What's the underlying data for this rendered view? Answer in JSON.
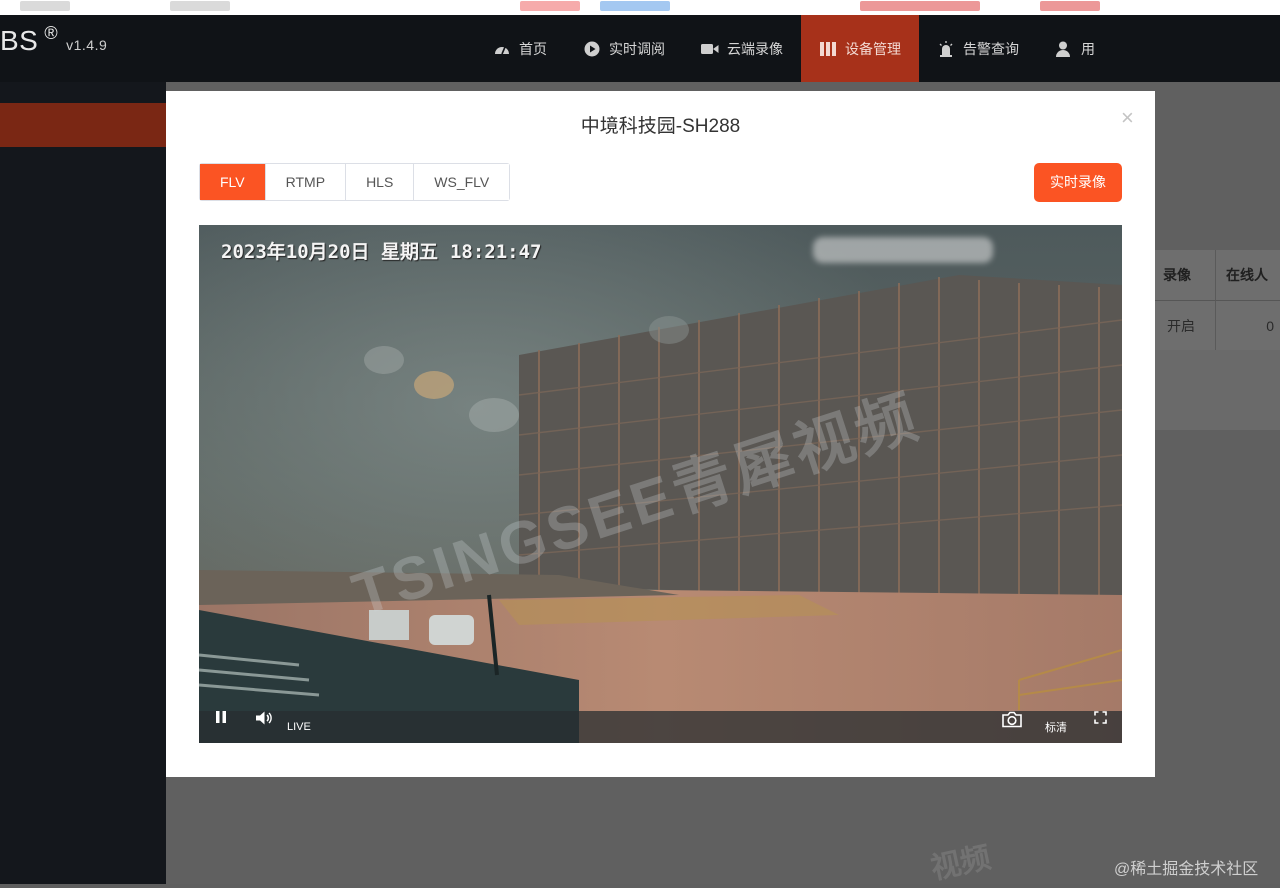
{
  "app": {
    "brand_name": "BS",
    "brand_mark": "®",
    "version": "v1.4.9"
  },
  "nav": {
    "items": [
      {
        "label": "首页",
        "icon": "dashboard-icon",
        "active": false
      },
      {
        "label": "实时调阅",
        "icon": "play-circle-icon",
        "active": false
      },
      {
        "label": "云端录像",
        "icon": "video-camera-icon",
        "active": false
      },
      {
        "label": "设备管理",
        "icon": "columns-icon",
        "active": true
      },
      {
        "label": "告警查询",
        "icon": "alarm-icon",
        "active": false
      },
      {
        "label": "用",
        "icon": "user-icon",
        "active": false
      }
    ]
  },
  "background_table": {
    "headers": [
      "录像",
      "在线人"
    ],
    "row": [
      "开启",
      "0"
    ]
  },
  "background_watermark": "视频",
  "site_watermark": "@稀土掘金技术社区",
  "modal": {
    "title": "中境科技园-SH288",
    "close_symbol": "×",
    "protocols": [
      {
        "label": "FLV",
        "active": true
      },
      {
        "label": "RTMP",
        "active": false
      },
      {
        "label": "HLS",
        "active": false
      },
      {
        "label": "WS_FLV",
        "active": false
      }
    ],
    "record_button": "实时录像"
  },
  "video": {
    "osd_date": "2023年10月20日  星期五",
    "osd_time": "18:21:47",
    "watermark": "TSINGSEE青犀视频",
    "live_label": "LIVE",
    "quality_label": "标清"
  },
  "colors": {
    "accent": "#fb5423",
    "nav_active": "#a7311a",
    "navbar_bg": "#101317"
  }
}
